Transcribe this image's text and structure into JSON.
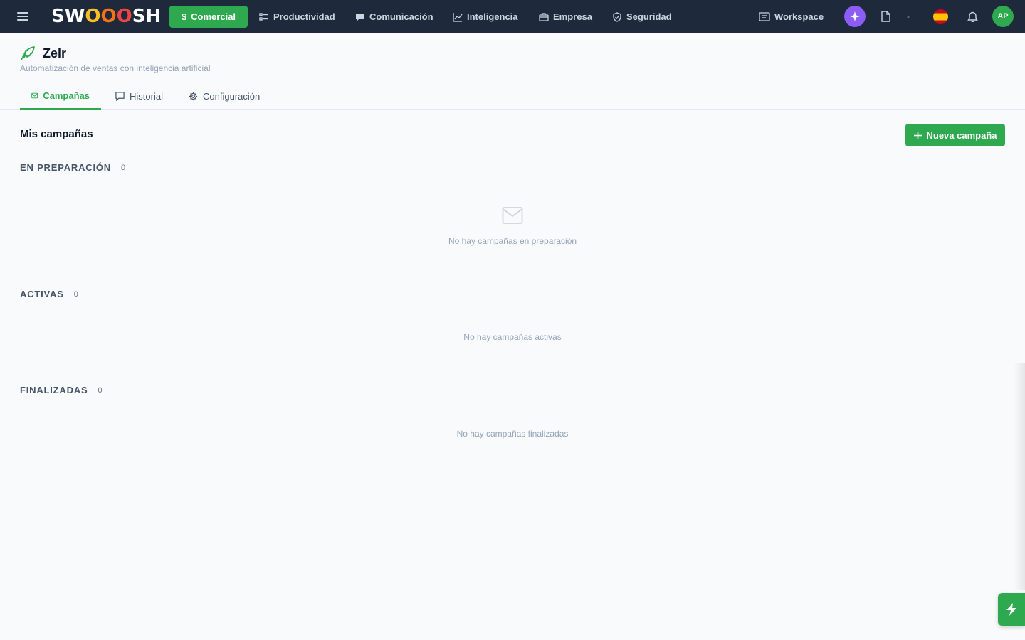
{
  "topbar": {
    "logo": {
      "s": "SW",
      "o1": "O",
      "o2": "O",
      "o3": "O",
      "end": "SH"
    },
    "nav": [
      {
        "label": "Comercial",
        "icon": "dollar-icon",
        "active": true
      },
      {
        "label": "Productividad",
        "icon": "checklist-icon"
      },
      {
        "label": "Comunicación",
        "icon": "chat-icon"
      },
      {
        "label": "Inteligencia",
        "icon": "chart-icon"
      },
      {
        "label": "Empresa",
        "icon": "briefcase-icon"
      },
      {
        "label": "Seguridad",
        "icon": "shield-icon"
      }
    ],
    "workspace_label": "Workspace",
    "dropdown_value": "-",
    "avatar_initials": "AP",
    "language": "es"
  },
  "app": {
    "title": "Zelr",
    "subtitle": "Automatización de ventas con inteligencia artificial",
    "icon": "rocket-icon"
  },
  "tabs": [
    {
      "label": "Campañas",
      "icon": "mail-icon",
      "active": true
    },
    {
      "label": "Historial",
      "icon": "message-icon"
    },
    {
      "label": "Configuración",
      "icon": "gear-icon"
    }
  ],
  "main": {
    "title": "Mis campañas",
    "new_button": "Nueva campaña",
    "groups": [
      {
        "title": "EN PREPARACIÓN",
        "count": "0",
        "empty_text": "No hay campañas en preparación"
      },
      {
        "title": "ACTIVAS",
        "count": "0",
        "empty_text": "No hay campañas activas"
      },
      {
        "title": "FINALIZADAS",
        "count": "0",
        "empty_text": "No hay campañas finalizadas"
      }
    ]
  },
  "colors": {
    "accent": "#2ea94f",
    "topbar": "#1e2a3b",
    "ai": "#8b5cf6"
  }
}
